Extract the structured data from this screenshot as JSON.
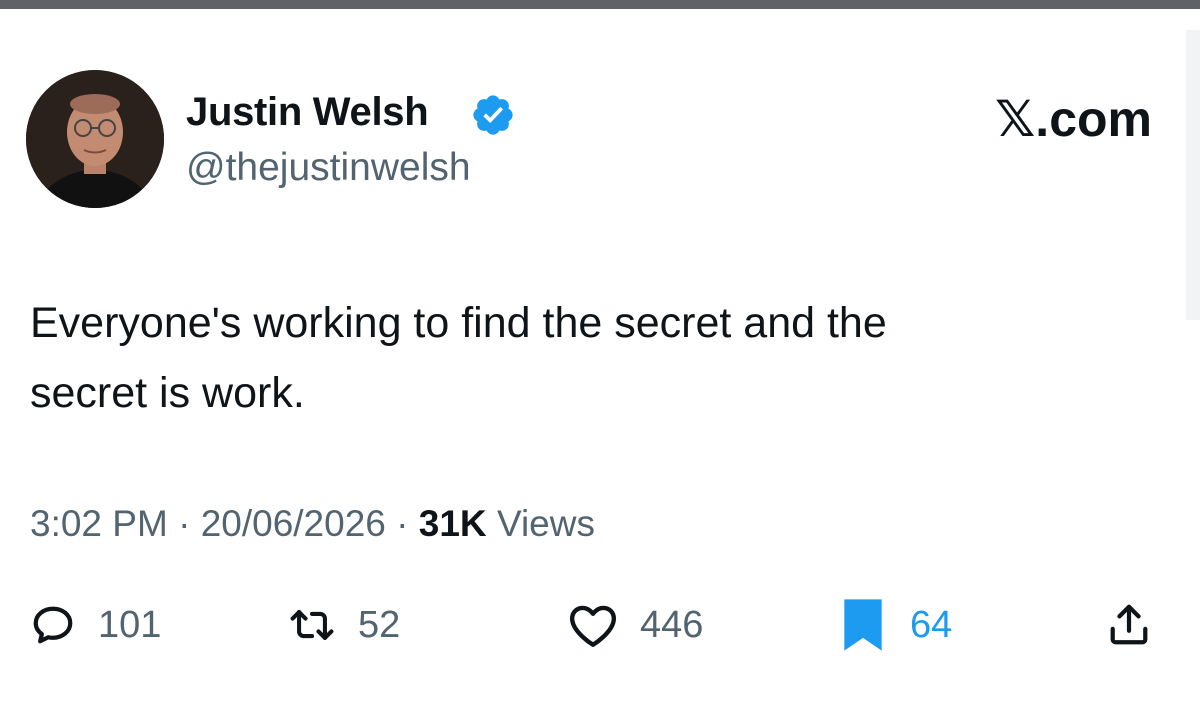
{
  "author": {
    "name": "Justin Welsh",
    "handle": "@thejustinwelsh",
    "verified": true
  },
  "brand": "𝕏.com",
  "tweet": {
    "text_line1": "Everyone's working to find the secret and the",
    "text_line2": "secret is work."
  },
  "meta": {
    "time": "3:02 PM",
    "separator": "·",
    "date": "20/06/2026",
    "views_count": "31K",
    "views_label": "Views"
  },
  "actions": {
    "replies": "101",
    "retweets": "52",
    "likes": "446",
    "bookmarks": "64"
  },
  "colors": {
    "verified": "#1d9bf0",
    "bookmark_active": "#1d9bf0",
    "secondary_text": "#536471",
    "primary_text": "#0f1419"
  }
}
